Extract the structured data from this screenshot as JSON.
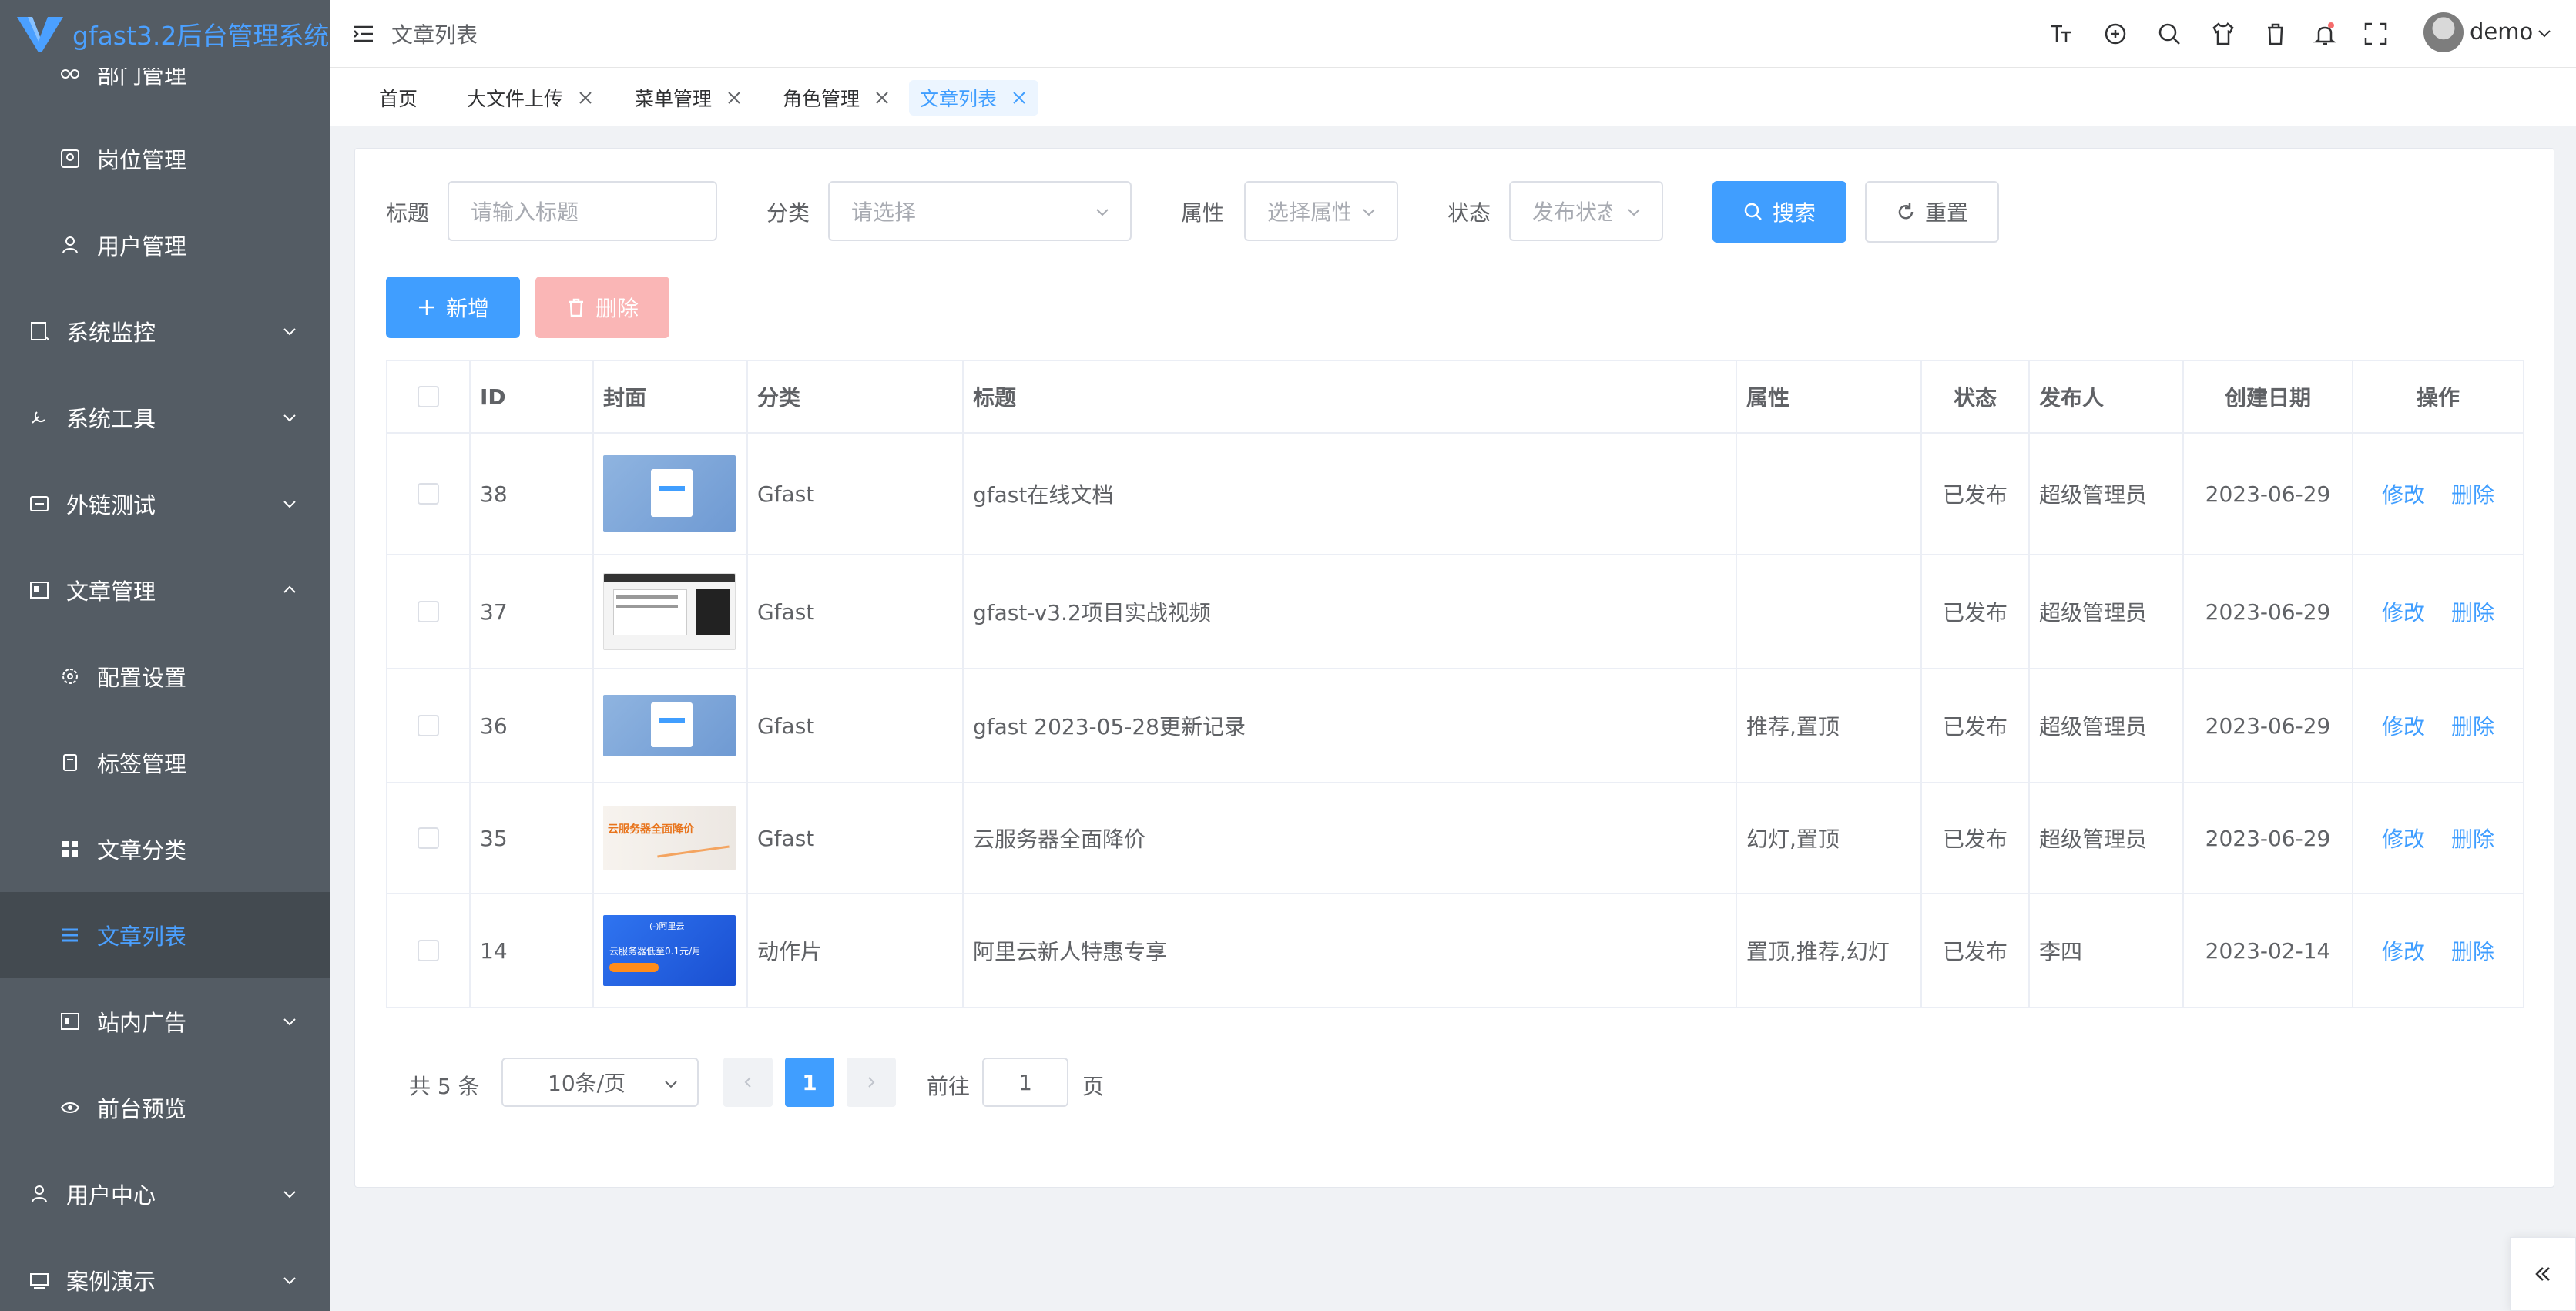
{
  "app": {
    "title": "gfast3.2后台管理系统",
    "brand_color": "#4ba0ff",
    "accent": "#409eff"
  },
  "sidebar": {
    "partial_item": "部门管理",
    "items": [
      {
        "label": "岗位管理",
        "icon": "position-icon"
      },
      {
        "label": "用户管理",
        "icon": "user-icon"
      },
      {
        "label": "系统监控",
        "icon": "monitor-icon",
        "expandable": true
      },
      {
        "label": "系统工具",
        "icon": "tools-icon",
        "expandable": true
      },
      {
        "label": "外链测试",
        "icon": "link-icon",
        "expandable": true
      },
      {
        "label": "文章管理",
        "icon": "article-icon",
        "expandable": true,
        "expanded": true
      },
      {
        "label": "配置设置",
        "icon": "settings-icon"
      },
      {
        "label": "标签管理",
        "icon": "tag-icon"
      },
      {
        "label": "文章分类",
        "icon": "category-icon"
      },
      {
        "label": "文章列表",
        "icon": "list-icon",
        "active": true
      },
      {
        "label": "站内广告",
        "icon": "ad-icon",
        "expandable": true
      },
      {
        "label": "前台预览",
        "icon": "eye-icon"
      },
      {
        "label": "用户中心",
        "icon": "user-center-icon",
        "expandable": true
      },
      {
        "label": "案例演示",
        "icon": "demo-icon",
        "expandable": true
      }
    ]
  },
  "header": {
    "breadcrumb": "文章列表",
    "user": "demo"
  },
  "tabs": [
    {
      "label": "首页",
      "closable": false
    },
    {
      "label": "大文件上传",
      "closable": true
    },
    {
      "label": "菜单管理",
      "closable": true
    },
    {
      "label": "角色管理",
      "closable": true
    },
    {
      "label": "文章列表",
      "closable": true,
      "active": true
    }
  ],
  "filters": {
    "title_label": "标题",
    "title_placeholder": "请输入标题",
    "category_label": "分类",
    "category_placeholder": "请选择",
    "attr_label": "属性",
    "attr_placeholder": "选择属性",
    "status_label": "状态",
    "status_placeholder": "发布状态",
    "search_label": "搜索",
    "reset_label": "重置"
  },
  "toolbar": {
    "add_label": "新增",
    "delete_label": "删除"
  },
  "table": {
    "columns": [
      "ID",
      "封面",
      "分类",
      "标题",
      "属性",
      "状态",
      "发布人",
      "创建日期",
      "操作"
    ],
    "rows": [
      {
        "id": "38",
        "cover": "blue-screenshot",
        "category": "Gfast",
        "title": "gfast在线文档",
        "attrs": "",
        "status": "已发布",
        "author": "超级管理员",
        "date": "2023-06-29",
        "edit": "修改",
        "del": "删除"
      },
      {
        "id": "37",
        "cover": "video-screenshot",
        "category": "Gfast",
        "title": "gfast-v3.2项目实战视频",
        "attrs": "",
        "status": "已发布",
        "author": "超级管理员",
        "date": "2023-06-29",
        "edit": "修改",
        "del": "删除"
      },
      {
        "id": "36",
        "cover": "blue-screenshot",
        "category": "Gfast",
        "title": "gfast 2023-05-28更新记录",
        "attrs": "推荐,置顶",
        "status": "已发布",
        "author": "超级管理员",
        "date": "2023-06-29",
        "edit": "修改",
        "del": "删除"
      },
      {
        "id": "35",
        "cover": "sale-banner",
        "category": "Gfast",
        "title": "云服务器全面降价",
        "attrs": "幻灯,置顶",
        "status": "已发布",
        "author": "超级管理员",
        "date": "2023-06-29",
        "edit": "修改",
        "del": "删除"
      },
      {
        "id": "14",
        "cover": "aliyun-banner",
        "category": "动作片",
        "title": "阿里云新人特惠专享",
        "attrs": "置顶,推荐,幻灯",
        "status": "已发布",
        "author": "李四",
        "date": "2023-02-14",
        "edit": "修改",
        "del": "删除"
      }
    ]
  },
  "cover_text": {
    "sale_banner": "云服务器全面降价",
    "aliyun_brand": "(-)阿里云",
    "aliyun_line1": "云服务器低至0.1元/月"
  },
  "pagination": {
    "total": "共 5 条",
    "page_size": "10条/页",
    "current": "1",
    "goto": "前往",
    "goto_value": "1",
    "page_suffix": "页"
  }
}
